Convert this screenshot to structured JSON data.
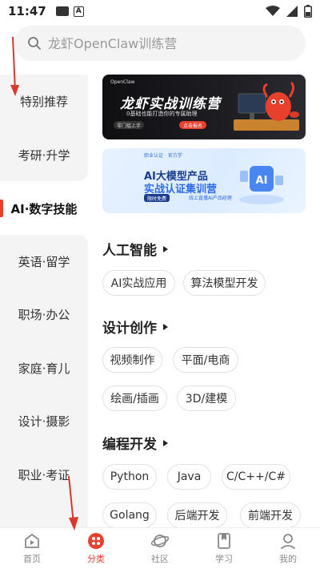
{
  "status_bar": {
    "time": "11:47",
    "badge": "A"
  },
  "search": {
    "placeholder": "龙虾OpenClaw训练营"
  },
  "sidebar": {
    "items": [
      {
        "label": "特别推荐",
        "active": false
      },
      {
        "label": "考研·升学",
        "active": false
      },
      {
        "label": "AI·数字技能",
        "active": true
      },
      {
        "label": "英语·留学",
        "active": false
      },
      {
        "label": "职场·办公",
        "active": false
      },
      {
        "label": "家庭·育儿",
        "active": false
      },
      {
        "label": "设计·摄影",
        "active": false
      },
      {
        "label": "职业·考证",
        "active": false
      }
    ]
  },
  "banners": {
    "banner1": {
      "title": "龙虾实战训练营",
      "subtitle": "0基础也能打造你的专属助理",
      "button": "点击报名",
      "tag": "零门槛上手",
      "top": "OpenClaw"
    },
    "banner2": {
      "top": "职业认证 · 官方学",
      "title1": "AI大模型产品",
      "title2": "实战认证集训营",
      "tag": "限时免费",
      "tag2": "线上直播AI产品经理"
    }
  },
  "sections": [
    {
      "title": "人工智能",
      "tags": [
        "AI实战应用",
        "算法模型开发"
      ]
    },
    {
      "title": "设计创作",
      "tags": [
        "视频制作",
        "平面/电商",
        "绘画/插画",
        "3D/建模"
      ]
    },
    {
      "title": "编程开发",
      "tags": [
        "Python",
        "Java",
        "C/C++/C#",
        "Golang",
        "后端开发",
        "前端开发"
      ]
    }
  ],
  "bottom_nav": {
    "items": [
      {
        "label": "首页",
        "icon": "home-play-icon",
        "active": false
      },
      {
        "label": "分类",
        "icon": "category-dots-icon",
        "active": true
      },
      {
        "label": "社区",
        "icon": "planet-icon",
        "active": false
      },
      {
        "label": "学习",
        "icon": "bookmark-book-icon",
        "active": false
      },
      {
        "label": "我的",
        "icon": "profile-icon",
        "active": false
      }
    ]
  },
  "colors": {
    "accent": "#e8402d",
    "sidebar_bg": "#f4f4f4",
    "annotation_arrow": "#d9382b"
  }
}
